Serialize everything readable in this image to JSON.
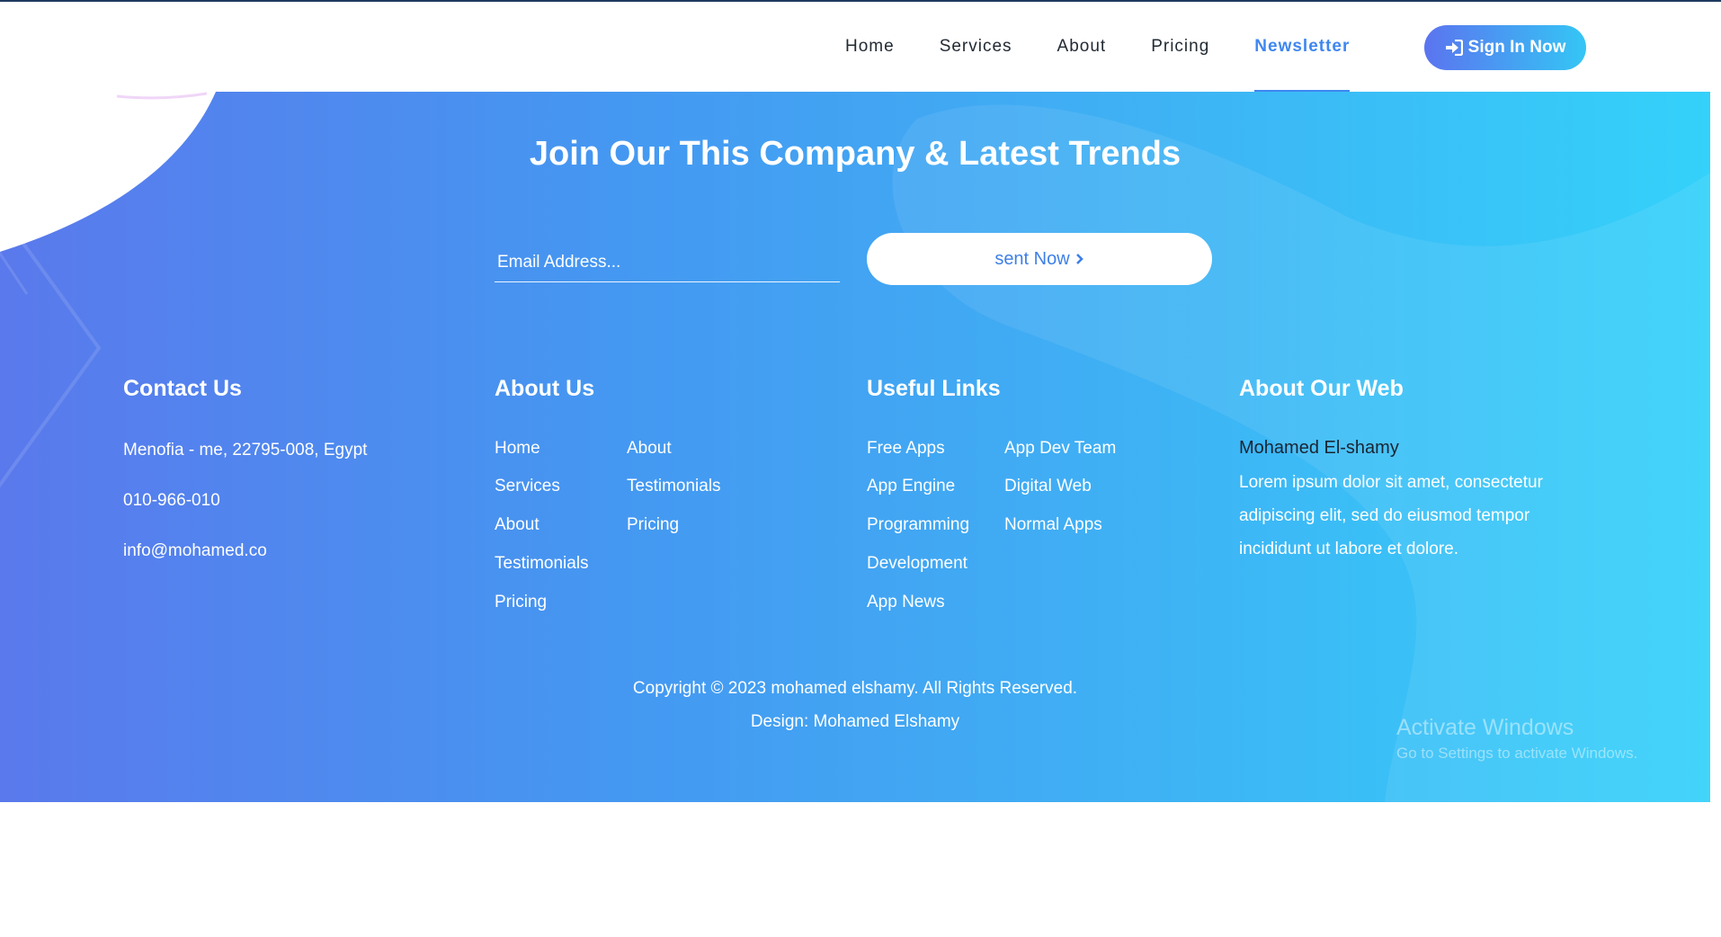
{
  "nav": {
    "items": [
      {
        "label": "Home",
        "active": false
      },
      {
        "label": "Services",
        "active": false
      },
      {
        "label": "About",
        "active": false
      },
      {
        "label": "Pricing",
        "active": false
      },
      {
        "label": "Newsletter",
        "active": true
      }
    ],
    "signin_label": "Sign In Now",
    "signin_icon": "sign-in-icon"
  },
  "newsletter": {
    "title": "Join Our This Company & Latest Trends",
    "email_placeholder": "Email Address...",
    "email_value": "",
    "button_label": "sent Now",
    "button_icon": "chevron-right-icon"
  },
  "contact": {
    "title": "Contact Us",
    "address": "Menofia - me, 22795-008, Egypt",
    "phone": "010-966-010",
    "email": "info@mohamed.co"
  },
  "about_us": {
    "title": "About Us",
    "col1": [
      "Home",
      "Services",
      "About",
      "Testimonials",
      "Pricing"
    ],
    "col2": [
      "About",
      "Testimonials",
      "Pricing"
    ]
  },
  "useful_links": {
    "title": "Useful Links",
    "col1": [
      "Free Apps",
      "App Engine",
      "Programming",
      "Development",
      "App News"
    ],
    "col2": [
      "App Dev Team",
      "Digital Web",
      "Normal Apps"
    ]
  },
  "about_web": {
    "title": "About Our Web",
    "author": "Mohamed El-shamy",
    "text": "Lorem ipsum dolor sit amet, consectetur adipiscing elit, sed do eiusmod tempor incididunt ut labore et dolore."
  },
  "footer": {
    "copyright": "Copyright © 2023 mohamed elshamy. All Rights Reserved.",
    "design": "Design: Mohamed Elshamy"
  },
  "watermark": {
    "title": "Activate Windows",
    "subtitle": "Go to Settings to activate Windows."
  },
  "colors": {
    "accent": "#3f87f0",
    "gradient_start": "#5a79ec",
    "gradient_end": "#34d1fa",
    "nav_text": "#222a33"
  }
}
